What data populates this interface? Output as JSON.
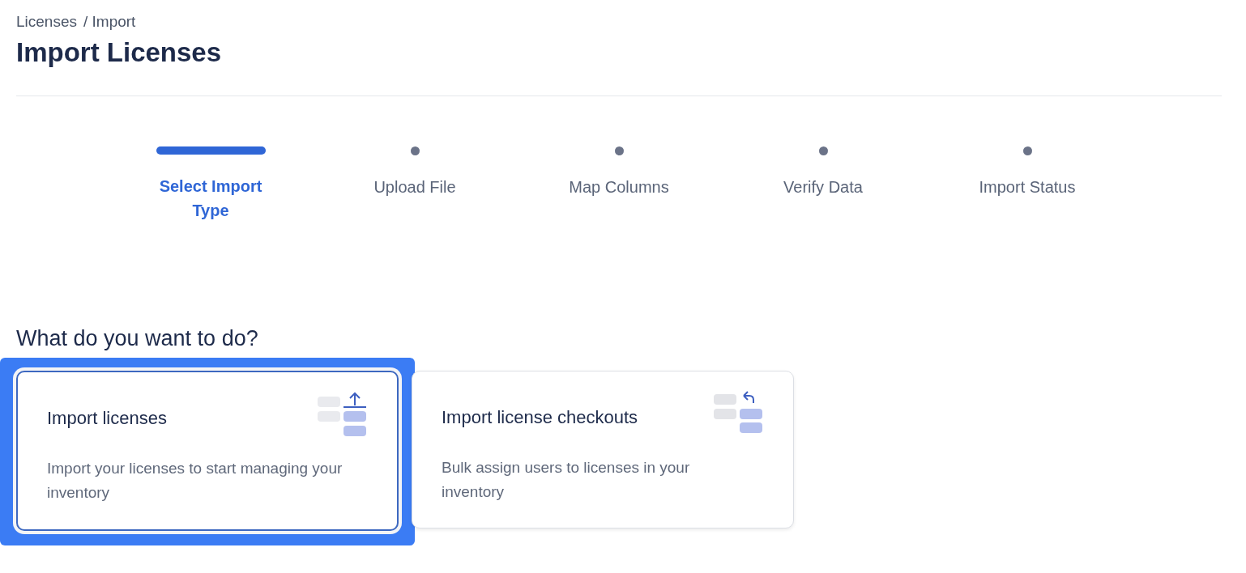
{
  "breadcrumb": [
    {
      "label": "Licenses"
    },
    {
      "label": "/ Import"
    }
  ],
  "title": "Import Licenses",
  "steps": [
    {
      "label": "Select Import Type",
      "selected": true
    },
    {
      "label": "Upload File",
      "selected": false
    },
    {
      "label": "Map Columns",
      "selected": false
    },
    {
      "label": "Verify Data",
      "selected": false
    },
    {
      "label": "Import Status",
      "selected": false
    }
  ],
  "question": "What do you want to do?",
  "options": [
    {
      "kind": "upload",
      "title": "Import licenses",
      "description": "Import your licenses to start managing your inventory",
      "selected": true
    },
    {
      "kind": "return",
      "title": "Import license checkouts",
      "description": "Bulk assign users to licenses in your inventory",
      "selected": false
    }
  ]
}
